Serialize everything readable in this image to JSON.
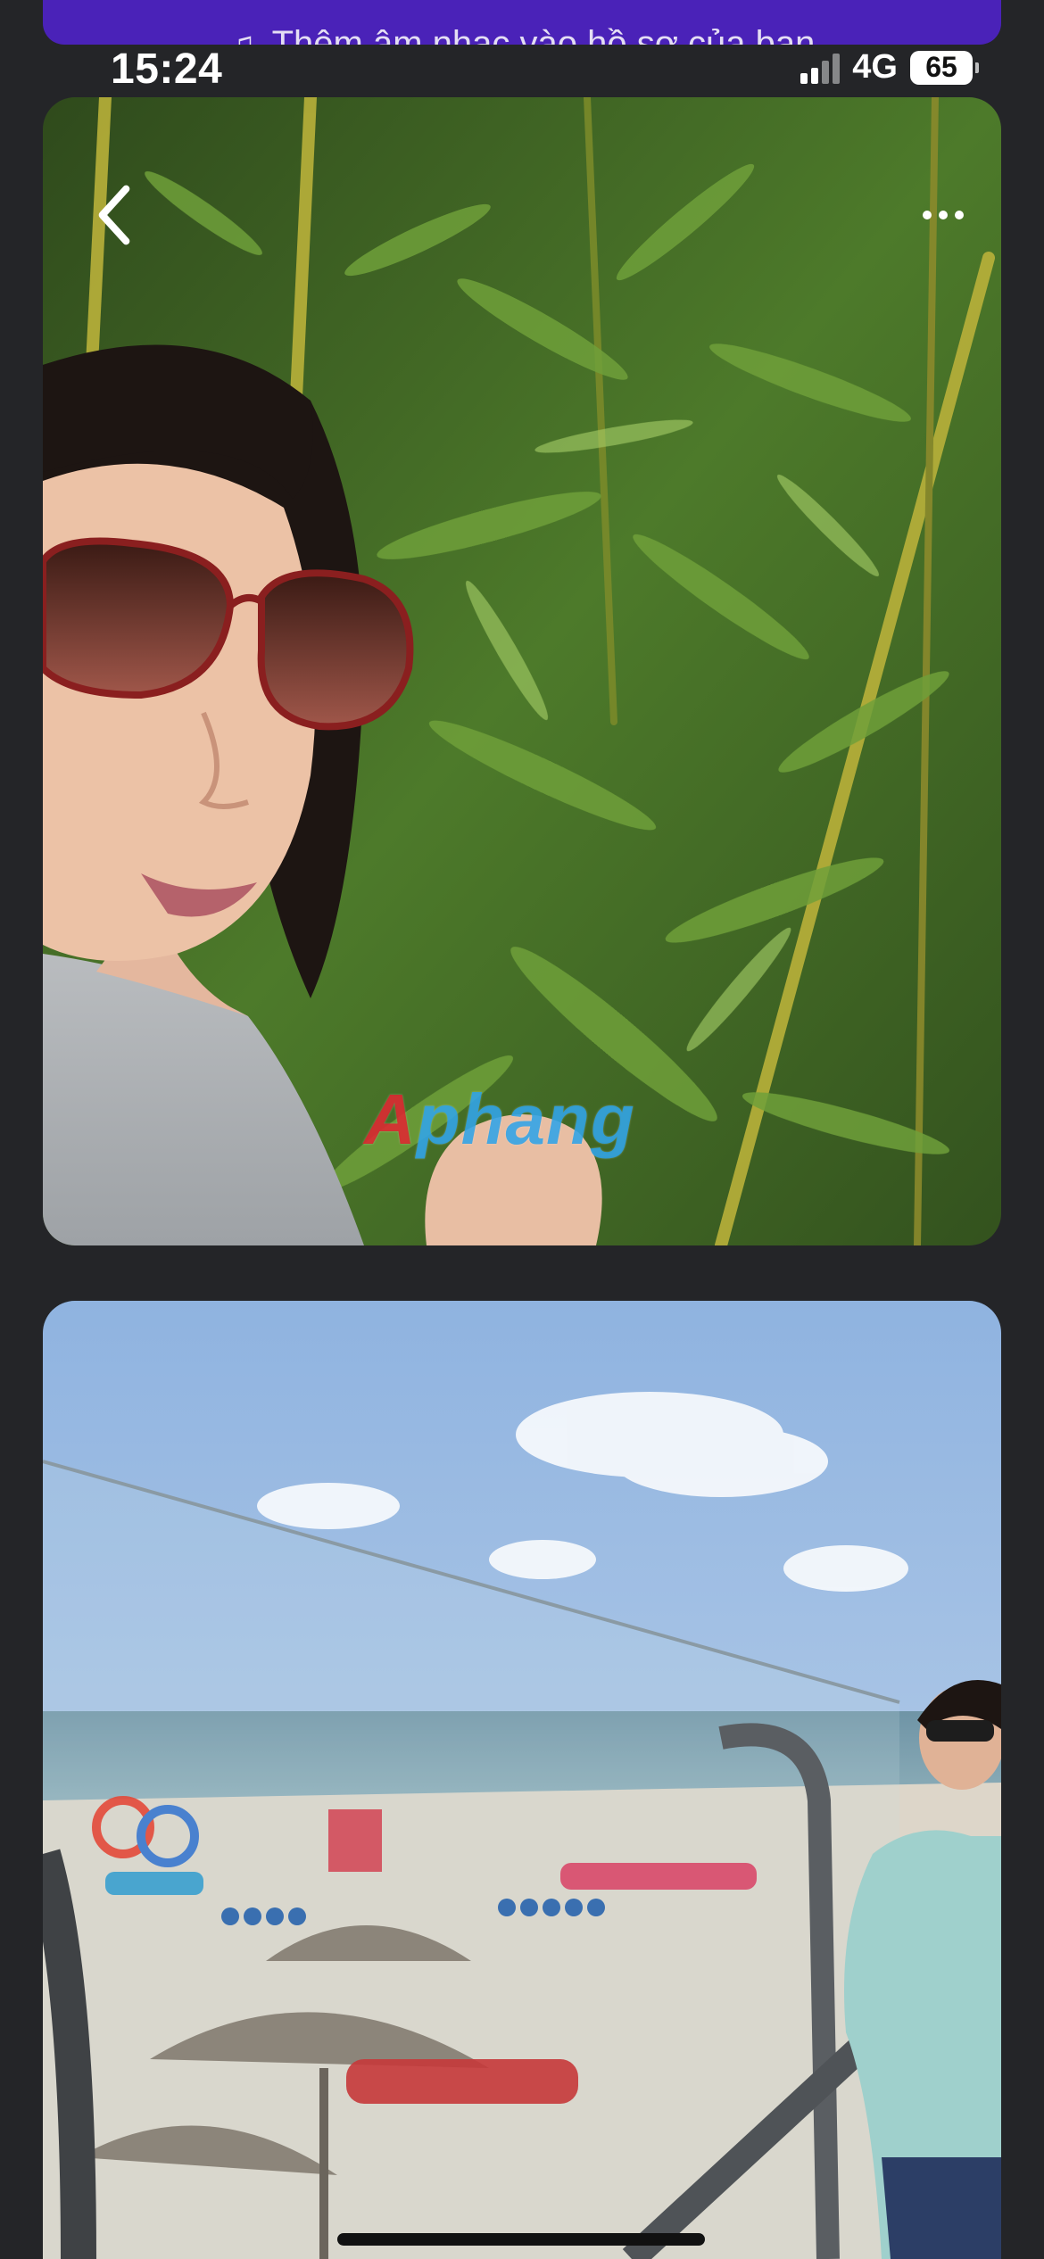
{
  "banner": {
    "icon": "music-note-icon",
    "text": "Thêm âm nhạc vào hồ sơ của bạn"
  },
  "status_bar": {
    "time": "15:24",
    "network": "4G",
    "battery": "65"
  },
  "nav": {
    "back_icon": "chevron-left-icon",
    "more_icon": "more-horizontal-icon"
  },
  "photos": [
    {
      "subject": "selfie-bamboo",
      "watermark_first": "A",
      "watermark_rest": "phang"
    },
    {
      "subject": "beach-balcony"
    }
  ],
  "colors": {
    "background": "#242528",
    "banner": "#4a22b8"
  }
}
